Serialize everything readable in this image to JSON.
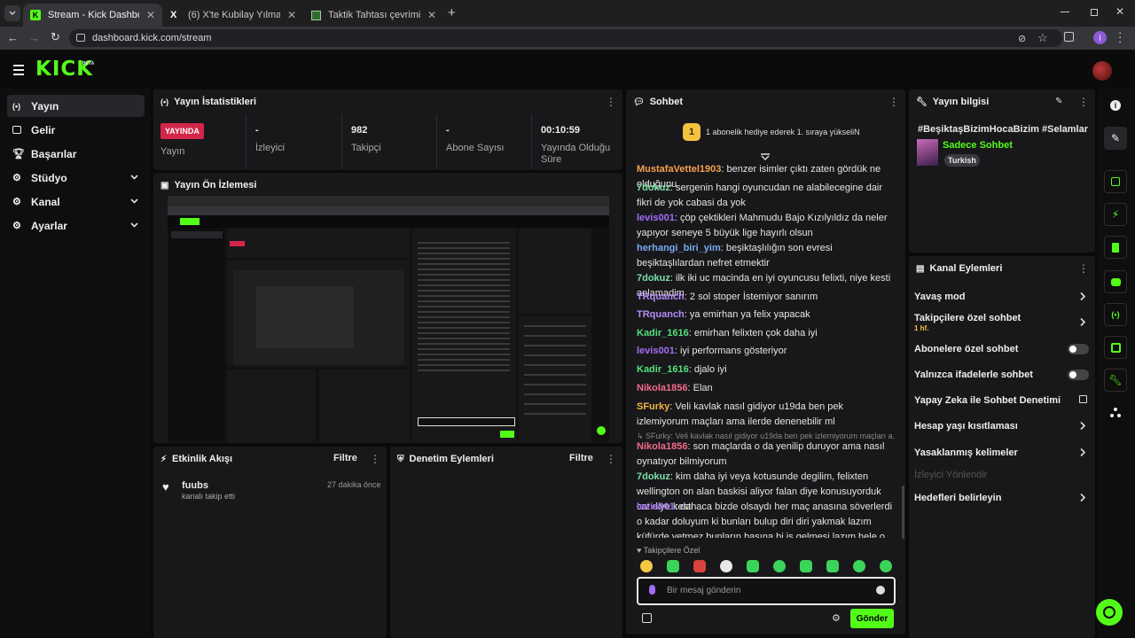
{
  "browser": {
    "tabs": [
      {
        "title": "Stream - Kick Dashboard",
        "icon": "kick-favicon-icon"
      },
      {
        "title": "(6) X'te Kubilay Yılmaz: \"He x-G",
        "icon": "x-favicon-icon"
      },
      {
        "title": "Taktik Tahtası çevrimiçi - Futbol",
        "icon": "tactics-favicon-icon"
      }
    ],
    "url": "dashboard.kick.com/stream",
    "profile_initial": "I"
  },
  "header": {
    "logo": "KICK",
    "beta": "BETA"
  },
  "sidebar": {
    "items": [
      {
        "label": "Yayın",
        "icon": "broadcast-icon",
        "active": true
      },
      {
        "label": "Gelir",
        "icon": "revenue-icon"
      },
      {
        "label": "Başarılar",
        "icon": "trophy-icon"
      },
      {
        "label": "Stüdyo",
        "icon": "studio-icon",
        "expandable": true
      },
      {
        "label": "Kanal",
        "icon": "channel-icon",
        "expandable": true
      },
      {
        "label": "Ayarlar",
        "icon": "gear-icon",
        "expandable": true
      }
    ]
  },
  "stats": {
    "title": "Yayın İstatistikleri",
    "live_badge": "YAYINDA",
    "live_label": "Yayın",
    "items": [
      {
        "value": "-",
        "label": "İzleyici"
      },
      {
        "value": "982",
        "label": "Takipçi"
      },
      {
        "value": "-",
        "label": "Abone Sayısı"
      },
      {
        "value": "00:10:59",
        "label": "Yayında Olduğu Süre"
      }
    ]
  },
  "preview": {
    "title": "Yayın Ön İzlemesi"
  },
  "activity": {
    "title": "Etkinlik Akışı",
    "filter": "Filtre",
    "events": [
      {
        "user": "fuubs",
        "text": "kanalı takip etti",
        "time": "27 dakika önce"
      }
    ]
  },
  "moderation": {
    "title": "Denetim Eylemleri",
    "filter": "Filtre"
  },
  "chat": {
    "title": "Sohbet",
    "gift_rank": "1",
    "gift_text": "1 abonelik hediye ederek 1. sıraya yükseliN",
    "messages": [
      {
        "user": "MustafaVettel1903",
        "color": "#f7a04b",
        "text": "benzer isimler çıktı zaten gördük ne olduğunu"
      },
      {
        "user": "7dokuz",
        "color": "#7be0a6",
        "text": "sergenin hangi oyuncudan ne alabilecegine dair fikri de yok cabasi da yok"
      },
      {
        "user": "levis001",
        "color": "#a36cf5",
        "text": "çöp çektikleri Mahmudu Bajo Kızılyıldız da neler yapıyor seneye 5 büyük lige hayırlı olsun"
      },
      {
        "user": "herhangi_biri_yim",
        "color": "#7aa8f0",
        "text": "beşiktaşlılığın son evresi beşiktaşlılardan nefret etmektir"
      },
      {
        "user": "7dokuz",
        "color": "#7be0a6",
        "text": "ilk iki uc macinda en iyi oyuncusu felixti, niye kesti anlamadim"
      },
      {
        "user": "TRquanch",
        "color": "#b48cf7",
        "text": "2 sol stoper İstemiyor sanırım"
      },
      {
        "user": "TRquanch",
        "color": "#b48cf7",
        "text": "ya emirhan ya felix yapacak"
      },
      {
        "user": "Kadir_1616",
        "color": "#53e07c",
        "text": "emirhan felixten çok daha iyi"
      },
      {
        "user": "levis001",
        "color": "#a36cf5",
        "text": "iyi performans gösteriyor"
      },
      {
        "user": "Kadir_1616",
        "color": "#53e07c",
        "text": "djalo iyi"
      },
      {
        "user": "Nikola1856",
        "color": "#f36b8a",
        "text": "Elan"
      },
      {
        "user": "SFurky",
        "color": "#f5b342",
        "text": "Veli kavlak nasıl gidiyor u19da ben pek izlemiyorum maçları ama ilerde denenebilir ml"
      },
      {
        "reply": "SFurky: Veli kavlak nasıl gidiyor u19da ben pek izlemiyorum maçları a...",
        "user": "Nikola1856",
        "color": "#f36b8a",
        "text": "son maçlarda o da yenilip duruyor ama nasıl oynatıyor bilmiyorum"
      },
      {
        "user": "7dokuz",
        "color": "#7be0a6",
        "text": "kim daha iyi veya kotusunde degilim, felixten wellington on alan baskisi aliyor falan diye konusuyorduk cat diye kesti"
      },
      {
        "user": "levis001",
        "color": "#a36cf5",
        "text": "dahaca bizde olsaydı her maç anasına söverlerdi o kadar doluyum ki bunları bulup diri diri yakmak lazım küfürde yetmez bunların başına bi iş gelmesi lazım hele o namussuz medyanın"
      }
    ],
    "followers_only": "Takipçilere Özel",
    "input_placeholder": "Bir mesaj gönderin",
    "send": "Gönder"
  },
  "stream_info": {
    "title": "Yayın bilgisi",
    "stream_title": "#BeşiktaşBizimHocaBizim #Selamlar",
    "category": "Sadece Sohbet",
    "tag": "Turkish"
  },
  "channel_actions": {
    "title": "Kanal Eylemleri",
    "items": [
      {
        "label": "Yavaş mod",
        "kind": "arrow"
      },
      {
        "label": "Takipçilere özel sohbet",
        "sub": "1 hf.",
        "kind": "arrow"
      },
      {
        "label": "Abonelere özel sohbet",
        "kind": "toggle",
        "on": false
      },
      {
        "label": "Yalnızca ifadelerle sohbet",
        "kind": "toggle",
        "on": false
      },
      {
        "label": "Yapay Zeka ile Sohbet Denetimi",
        "kind": "external"
      },
      {
        "label": "Hesap yaşı kısıtlaması",
        "kind": "arrow"
      },
      {
        "label": "Yasaklanmış kelimeler",
        "kind": "arrow"
      },
      {
        "label": "İzleyici Yönlendir",
        "kind": "disabled"
      },
      {
        "label": "Hedefleri belirleyin",
        "kind": "arrow"
      }
    ]
  },
  "colors": {
    "accent": "#53fc18",
    "live": "#d32649",
    "panel": "#18181b"
  }
}
